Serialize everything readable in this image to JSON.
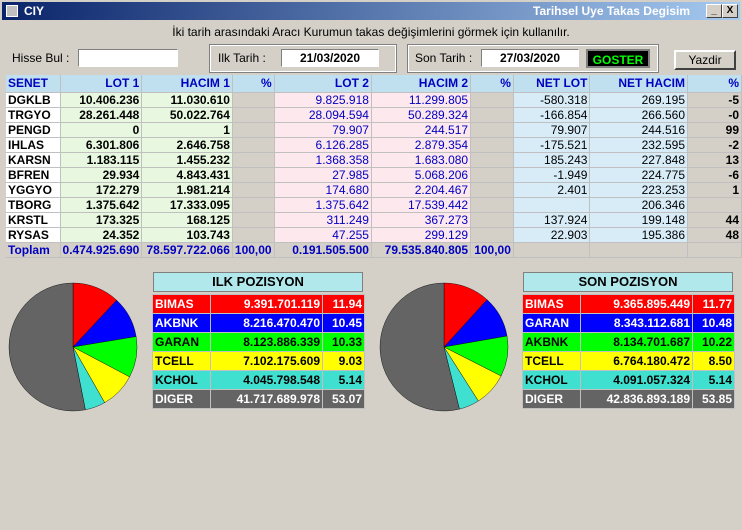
{
  "window": {
    "title_left": "CIY",
    "title_right": "Tarihsel Uye Takas Degisim",
    "minimize": "_",
    "close": "X"
  },
  "info_text": "İki tarih arasındaki  Aracı Kurumun takas değişimlerini görmek için kullanılır.",
  "controls": {
    "hisse_label": "Hisse Bul :",
    "hisse_value": "",
    "ilk_label": "Ilk Tarih :",
    "ilk_value": "21/03/2020",
    "son_label": "Son Tarih :",
    "son_value": "27/03/2020",
    "goster": "GOSTER",
    "yazdir": "Yazdir"
  },
  "table": {
    "headers": [
      "SENET",
      "LOT 1",
      "HACIM 1",
      "%",
      "LOT 2",
      "HACIM 2",
      "%",
      "NET LOT",
      "NET HACIM",
      "%"
    ],
    "rows": [
      [
        "DGKLB",
        "10.406.236",
        "11.030.610",
        "",
        "9.825.918",
        "11.299.805",
        "",
        "-580.318",
        "269.195",
        "-5"
      ],
      [
        "TRGYO",
        "28.261.448",
        "50.022.764",
        "",
        "28.094.594",
        "50.289.324",
        "",
        "-166.854",
        "266.560",
        "-0"
      ],
      [
        "PENGD",
        "0",
        "1",
        "",
        "79.907",
        "244.517",
        "",
        "79.907",
        "244.516",
        "99"
      ],
      [
        "IHLAS",
        "6.301.806",
        "2.646.758",
        "",
        "6.126.285",
        "2.879.354",
        "",
        "-175.521",
        "232.595",
        "-2"
      ],
      [
        "KARSN",
        "1.183.115",
        "1.455.232",
        "",
        "1.368.358",
        "1.683.080",
        "",
        "185.243",
        "227.848",
        "13"
      ],
      [
        "BFREN",
        "29.934",
        "4.843.431",
        "",
        "27.985",
        "5.068.206",
        "",
        "-1.949",
        "224.775",
        "-6"
      ],
      [
        "YGGYO",
        "172.279",
        "1.981.214",
        "",
        "174.680",
        "2.204.467",
        "",
        "2.401",
        "223.253",
        "1"
      ],
      [
        "TBORG",
        "1.375.642",
        "17.333.095",
        "",
        "1.375.642",
        "17.539.442",
        "",
        "",
        "206.346",
        ""
      ],
      [
        "KRSTL",
        "173.325",
        "168.125",
        "",
        "311.249",
        "367.273",
        "",
        "137.924",
        "199.148",
        "44"
      ],
      [
        "RYSAS",
        "24.352",
        "103.743",
        "",
        "47.255",
        "299.129",
        "",
        "22.903",
        "195.386",
        "48"
      ]
    ],
    "total": [
      "Toplam",
      "0.474.925.690",
      "78.597.722.066",
      "100,00",
      "0.191.505.500",
      "79.535.840.805",
      "100,00",
      "",
      "",
      ""
    ]
  },
  "ilk_pozisyon": {
    "title": "ILK POZISYON",
    "rows": [
      {
        "name": "BIMAS",
        "value": "9.391.701.119",
        "pct": "11.94",
        "color": "#ff0000",
        "text": "#ffffff"
      },
      {
        "name": "AKBNK",
        "value": "8.216.470.470",
        "pct": "10.45",
        "color": "#0000ff",
        "text": "#ffffff"
      },
      {
        "name": "GARAN",
        "value": "8.123.886.339",
        "pct": "10.33",
        "color": "#00ff00",
        "text": "#000000"
      },
      {
        "name": "TCELL",
        "value": "7.102.175.609",
        "pct": "9.03",
        "color": "#ffff00",
        "text": "#000000"
      },
      {
        "name": "KCHOL",
        "value": "4.045.798.548",
        "pct": "5.14",
        "color": "#40e0d0",
        "text": "#000000"
      },
      {
        "name": "DIGER",
        "value": "41.717.689.978",
        "pct": "53.07",
        "color": "#646464",
        "text": "#ffffff"
      }
    ]
  },
  "son_pozisyon": {
    "title": "SON POZISYON",
    "rows": [
      {
        "name": "BIMAS",
        "value": "9.365.895.449",
        "pct": "11.77",
        "color": "#ff0000",
        "text": "#ffffff"
      },
      {
        "name": "GARAN",
        "value": "8.343.112.681",
        "pct": "10.48",
        "color": "#0000ff",
        "text": "#ffffff"
      },
      {
        "name": "AKBNK",
        "value": "8.134.701.687",
        "pct": "10.22",
        "color": "#00ff00",
        "text": "#000000"
      },
      {
        "name": "TCELL",
        "value": "6.764.180.472",
        "pct": "8.50",
        "color": "#ffff00",
        "text": "#000000"
      },
      {
        "name": "KCHOL",
        "value": "4.091.057.324",
        "pct": "5.14",
        "color": "#40e0d0",
        "text": "#000000"
      },
      {
        "name": "DIGER",
        "value": "42.836.893.189",
        "pct": "53.85",
        "color": "#646464",
        "text": "#ffffff"
      }
    ]
  }
}
